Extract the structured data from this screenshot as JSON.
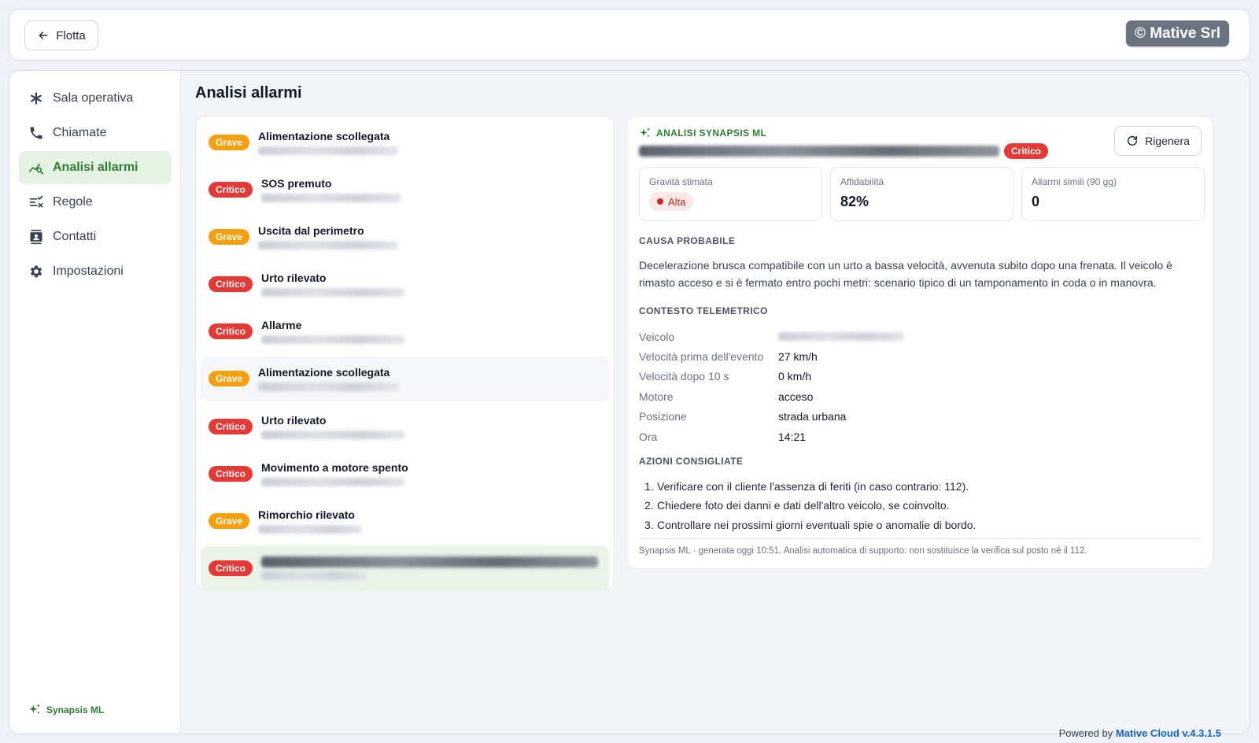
{
  "topbar": {
    "back_label": "Flotta",
    "brand_badge": "© Mative Srl"
  },
  "sidebar": {
    "items": [
      {
        "label": "Sala operativa",
        "icon": "asterisk-icon"
      },
      {
        "label": "Chiamate",
        "icon": "phone-icon"
      },
      {
        "label": "Analisi allarmi",
        "icon": "chart-search-icon",
        "active": true
      },
      {
        "label": "Regole",
        "icon": "rules-list-icon"
      },
      {
        "label": "Contatti",
        "icon": "contacts-icon"
      },
      {
        "label": "Impostazioni",
        "icon": "gear-icon"
      }
    ],
    "footer": "Synapsis ML"
  },
  "page": {
    "title": "Analisi allarmi"
  },
  "alarms": [
    {
      "severity": "Grave",
      "title": "Alimentazione scollegata"
    },
    {
      "severity": "Critico",
      "title": "SOS premuto"
    },
    {
      "severity": "Grave",
      "title": "Uscita dal perimetro"
    },
    {
      "severity": "Critico",
      "title": "Urto rilevato"
    },
    {
      "severity": "Critico",
      "title": "Allarme"
    },
    {
      "severity": "Grave",
      "title": "Alimentazione scollegata"
    },
    {
      "severity": "Critico",
      "title": "Urto rilevato"
    },
    {
      "severity": "Critico",
      "title": "Movimento a motore spento"
    },
    {
      "severity": "Grave",
      "title": "Rimorchio rilevato"
    },
    {
      "severity": "Critico",
      "title": ""
    }
  ],
  "analysis": {
    "kicker": "ANALISI SYNAPSIS ML",
    "severity_badge": "Critico",
    "regen_label": "Rigenera",
    "metrics": {
      "gravity_label": "Gravità stimata",
      "gravity_value": "Alta",
      "reliability_label": "Affidabilità",
      "reliability_value": "82%",
      "similar_label": "Allarmi simili (90 gg)",
      "similar_value": "0"
    },
    "cause_heading": "CAUSA PROBABILE",
    "cause_text": "Decelerazione brusca compatibile con un urto a bassa velocità, avvenuta subito dopo una frenata. Il veicolo è rimasto acceso e si è fermato entro pochi metri: scenario tipico di un tamponamento in coda o in manovra.",
    "telemetry_heading": "CONTESTO TELEMETRICO",
    "telemetry": [
      {
        "key": "Veicolo",
        "value": ""
      },
      {
        "key": "Velocità prima dell'evento",
        "value": "27 km/h"
      },
      {
        "key": "Velocità dopo 10 s",
        "value": "0 km/h"
      },
      {
        "key": "Motore",
        "value": "acceso"
      },
      {
        "key": "Posizione",
        "value": "strada urbana"
      },
      {
        "key": "Ora",
        "value": "14:21"
      }
    ],
    "actions_heading": "AZIONI CONSIGLIATE",
    "actions": [
      "Verificare con il cliente l'assenza di feriti (in caso contrario: 112).",
      "Chiedere foto dei danni e dati dell'altro veicolo, se coinvolto.",
      "Controllare nei prossimi giorni eventuali spie o anomalie di bordo."
    ],
    "footer": "Synapsis ML · generata oggi 10:51. Analisi automatica di supporto: non sostituisce la verifica sul posto né il 112."
  },
  "powered": {
    "prefix": "Powered by",
    "product": "Mative Cloud v.4.3.1.5"
  },
  "colors": {
    "accent_green": "#2e7d32",
    "grave": "#f5a00c",
    "critico": "#e53935",
    "link_blue": "#1565c0"
  }
}
